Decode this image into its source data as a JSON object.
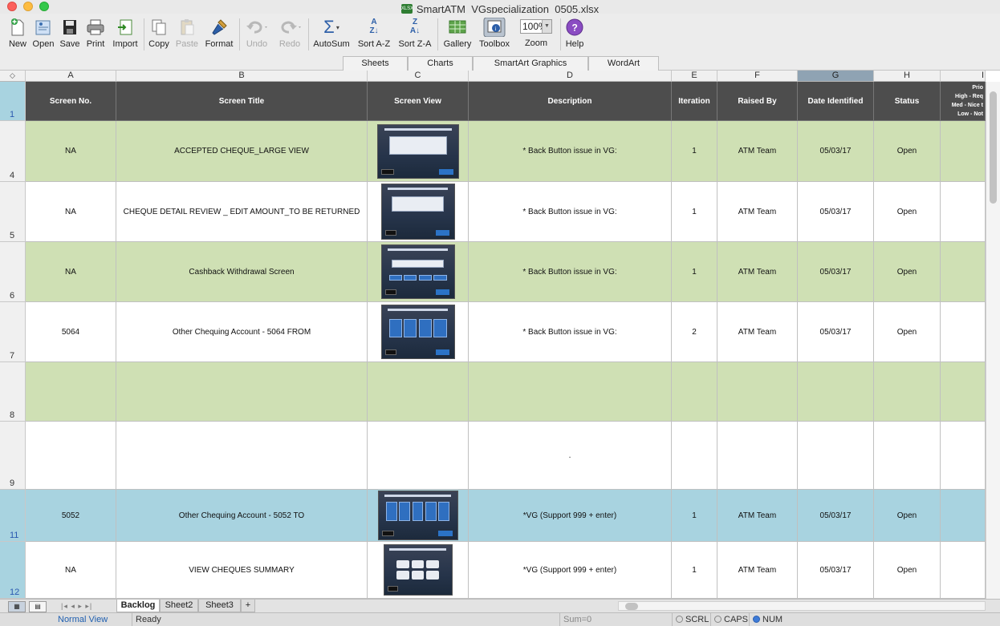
{
  "window": {
    "title": "SmartATM_VGspecialization_0505.xlsx"
  },
  "toolbar": {
    "new": "New",
    "open": "Open",
    "save": "Save",
    "print": "Print",
    "import": "Import",
    "copy": "Copy",
    "paste": "Paste",
    "format": "Format",
    "undo": "Undo",
    "redo": "Redo",
    "autosum": "AutoSum",
    "sort_az": "Sort A-Z",
    "sort_za": "Sort Z-A",
    "gallery": "Gallery",
    "toolbox": "Toolbox",
    "zoom_label": "Zoom",
    "zoom_value": "100%",
    "help": "Help"
  },
  "ribbon": {
    "sheets": "Sheets",
    "charts": "Charts",
    "smartart": "SmartArt Graphics",
    "wordart": "WordArt"
  },
  "columns": {
    "a": "A",
    "b": "B",
    "c": "C",
    "d": "D",
    "e": "E",
    "f": "F",
    "g": "G",
    "h": "H",
    "i": "I"
  },
  "header": {
    "row_num": "1",
    "screen_no": "Screen No.",
    "screen_title": "Screen  Title",
    "screen_view": "Screen View",
    "description": "Description",
    "iteration": "Iteration",
    "raised_by": "Raised By",
    "date_identified": "Date Identified",
    "status": "Status",
    "priority_1": "Prio",
    "priority_2": "High - Req",
    "priority_3": "Med - Nice t",
    "priority_4": "Low - Not"
  },
  "rows": [
    {
      "num": "4",
      "screen_no": "NA",
      "title": "ACCEPTED CHEQUE_LARGE VIEW",
      "description": "* Back Button issue in VG:",
      "iteration": "1",
      "raised_by": "ATM Team",
      "date": "05/03/17",
      "status": "Open"
    },
    {
      "num": "5",
      "screen_no": "NA",
      "title": "CHEQUE DETAIL REVIEW _ EDIT AMOUNT_TO BE RETURNED",
      "description": "* Back Button issue in VG:",
      "iteration": "1",
      "raised_by": "ATM Team",
      "date": "05/03/17",
      "status": "Open"
    },
    {
      "num": "6",
      "screen_no": "NA",
      "title": "Cashback Withdrawal Screen",
      "description": "* Back Button issue in VG:",
      "iteration": "1",
      "raised_by": "ATM Team",
      "date": "05/03/17",
      "status": "Open"
    },
    {
      "num": "7",
      "screen_no": "5064",
      "title": "Other Chequing Account - 5064 FROM",
      "description": "* Back Button issue in VG:",
      "iteration": "2",
      "raised_by": "ATM Team",
      "date": "05/03/17",
      "status": "Open"
    },
    {
      "num": "8",
      "screen_no": "",
      "title": "",
      "description": "",
      "iteration": "",
      "raised_by": "",
      "date": "",
      "status": ""
    },
    {
      "num": "9",
      "screen_no": "",
      "title": "",
      "description": ".",
      "iteration": "",
      "raised_by": "",
      "date": "",
      "status": ""
    },
    {
      "num": "11",
      "screen_no": "5052",
      "title": "Other Chequing Account - 5052 TO",
      "description": "*VG (Support 999  + enter)",
      "iteration": "1",
      "raised_by": "ATM Team",
      "date": "05/03/17",
      "status": "Open"
    },
    {
      "num": "12",
      "screen_no": "NA",
      "title": "VIEW CHEQUES SUMMARY",
      "description": "*VG (Support 999  + enter)",
      "iteration": "1",
      "raised_by": "ATM Team",
      "date": "05/03/17",
      "status": "Open"
    }
  ],
  "sheet_tabs": {
    "backlog": "Backlog",
    "sheet2": "Sheet2",
    "sheet3": "Sheet3",
    "add": "+"
  },
  "status": {
    "view": "Normal View",
    "ready": "Ready",
    "sum": "Sum=0",
    "scrl": "SCRL",
    "caps": "CAPS",
    "num": "NUM"
  }
}
